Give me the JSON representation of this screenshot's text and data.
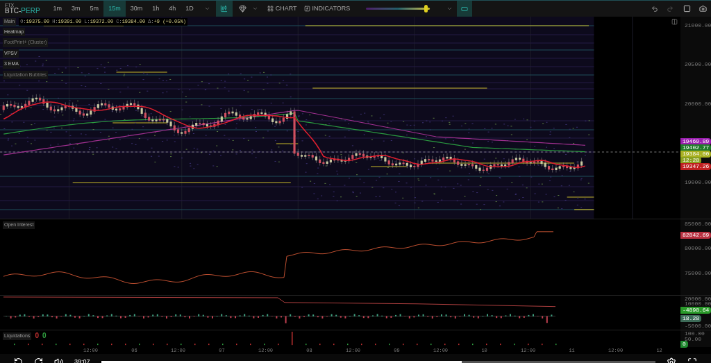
{
  "toolbar": {
    "exchange": "FTX",
    "symbol": "BTC-",
    "symbol_suffix": "PERP",
    "timeframes": [
      {
        "label": "1m",
        "selected": false
      },
      {
        "label": "3m",
        "selected": false
      },
      {
        "label": "5m",
        "selected": false
      },
      {
        "label": "15m",
        "selected": true
      },
      {
        "label": "30m",
        "selected": false
      },
      {
        "label": "1h",
        "selected": false
      },
      {
        "label": "4h",
        "selected": false
      },
      {
        "label": "1D",
        "selected": false
      }
    ],
    "chart_button": "CHART",
    "indicators_button": "INDICATORS",
    "heatmap_contrast": {
      "level": 0.93
    }
  },
  "legend": {
    "pane": "Main",
    "ohlc": [
      {
        "label": "O:",
        "value": "19375.00"
      },
      {
        "label": "H:",
        "value": "19391.00"
      },
      {
        "label": "L:",
        "value": "19372.00"
      },
      {
        "label": "C:",
        "value": "19384.00"
      },
      {
        "label": "Δ:",
        "value": "+9 (+0.05%)"
      }
    ]
  },
  "layers": [
    {
      "label": "Heatmap",
      "enabled": true
    },
    {
      "label": "FootPrint+ (Cluster)",
      "enabled": false
    },
    {
      "label": "VPSV",
      "enabled": true
    },
    {
      "label": "3 EMA",
      "enabled": true
    },
    {
      "label": "Liquidation Bubbles",
      "enabled": false
    }
  ],
  "price_axis": {
    "ticks": [
      "21000.00",
      "20500.00",
      "20000.00",
      "19000.00"
    ],
    "tags": [
      {
        "value": "19469.89",
        "color": "#9b1fb0"
      },
      {
        "value": "19402.77",
        "color": "#1f7a2a"
      },
      {
        "value": "19384.00",
        "color": "#a8b020"
      },
      {
        "value": "12:28",
        "color": "#8aa020"
      },
      {
        "value": "19347.26",
        "color": "#c02020"
      }
    ]
  },
  "open_interest": {
    "title": "Open Interest",
    "ticks": [
      "85000.00",
      "80000.00",
      "75000.00"
    ],
    "tags": [
      {
        "value": "82842.69",
        "color": "#b83040"
      }
    ]
  },
  "delta": {
    "ticks": [
      "20000.00",
      "10000.00",
      "-5000.00"
    ],
    "tags": [
      {
        "value": "-4898.64",
        "color": "#2a9a2a"
      },
      {
        "value": "18.28",
        "color": "#3d6b58"
      }
    ]
  },
  "liquidations": {
    "title": "Liquidations",
    "counts": [
      {
        "value": "0",
        "color": "#c03030"
      },
      {
        "value": "0",
        "color": "#30a040"
      }
    ],
    "ticks": [
      "100.00",
      "50.00"
    ],
    "tags": [
      {
        "value": "0",
        "color": "#208a30"
      }
    ]
  },
  "time_axis": [
    "12:00",
    "06",
    "12:00",
    "07",
    "12:00",
    "08",
    "12:00",
    "09",
    "12:00",
    "10",
    "12:00",
    "11",
    "12:00",
    "12"
  ],
  "player": {
    "time": "39:07",
    "progress": {
      "level": 0.65
    }
  }
}
